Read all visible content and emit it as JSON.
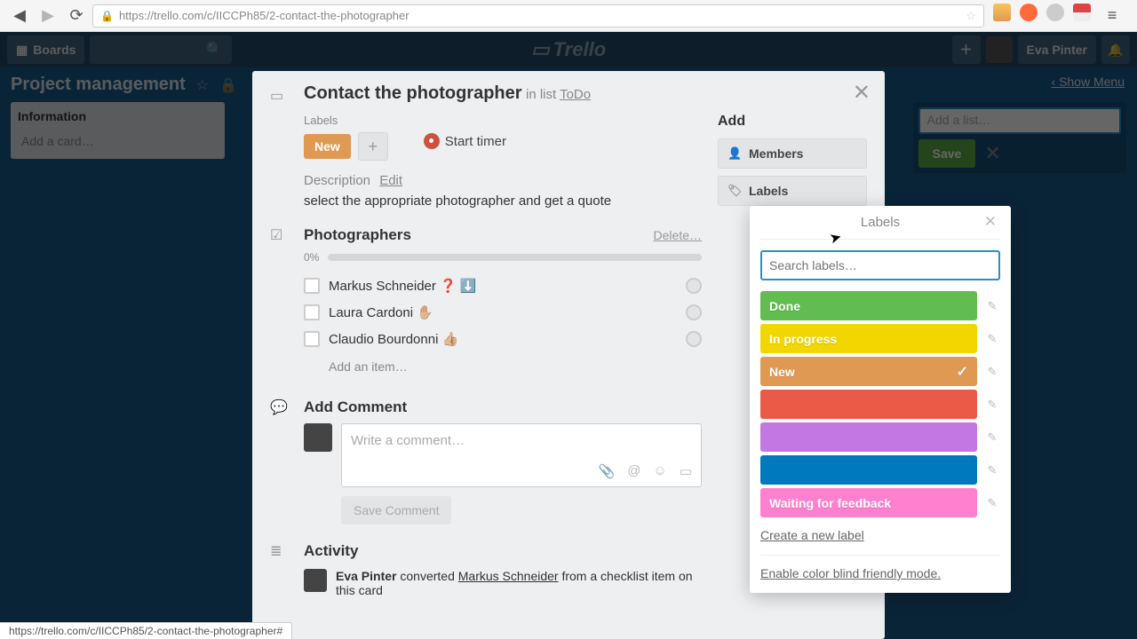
{
  "browser": {
    "url": "https://trello.com/c/IICCPh85/2-contact-the-photographer",
    "status_url": "https://trello.com/c/IICCPh85/2-contact-the-photographer#"
  },
  "header": {
    "boards": "Boards",
    "logo": "Trello",
    "user": "Eva Pinter"
  },
  "board": {
    "name": "Project management",
    "show_menu": "Show Menu",
    "list1_title": "Information",
    "add_card": "Add a card…",
    "add_list_placeholder": "Add a list…",
    "save": "Save"
  },
  "card": {
    "title": "Contact the photographer",
    "in_list_prefix": "in list ",
    "in_list_name": "ToDo",
    "labels_label": "Labels",
    "label_chip": "New",
    "start_timer": "Start timer",
    "description_label": "Description",
    "edit": "Edit",
    "description_text": "select the appropriate photographer and get a quote",
    "checklist_title": "Photographers",
    "delete": "Delete…",
    "progress": "0%",
    "items": [
      "Markus Schneider ❓ ⬇️",
      "Laura Cardoni ✋🏼",
      "Claudio Bourdonni 👍🏼"
    ],
    "add_item": "Add an item…",
    "add_comment_title": "Add Comment",
    "comment_placeholder": "Write a comment…",
    "save_comment": "Save Comment",
    "activity_title": "Activity",
    "activity_user": "Eva Pinter",
    "activity_middle": " converted ",
    "activity_link": "Markus Schneider",
    "activity_suffix": " from a checklist item on this card"
  },
  "sidebar": {
    "add_title": "Add",
    "members": "Members",
    "labels": "Labels"
  },
  "popover": {
    "title": "Labels",
    "search_placeholder": "Search labels…",
    "labels": [
      {
        "text": "Done",
        "color": "#61bd4f",
        "checked": false
      },
      {
        "text": "In progress",
        "color": "#f2d600",
        "checked": false
      },
      {
        "text": "New",
        "color": "#e09952",
        "checked": true
      },
      {
        "text": "",
        "color": "#eb5a46",
        "checked": false
      },
      {
        "text": "",
        "color": "#c377e0",
        "checked": false
      },
      {
        "text": "",
        "color": "#0079bf",
        "checked": false
      },
      {
        "text": "Waiting for feedback",
        "color": "#ff80ce",
        "checked": false
      }
    ],
    "create": "Create a new label",
    "colorblind": "Enable color blind friendly mode."
  }
}
